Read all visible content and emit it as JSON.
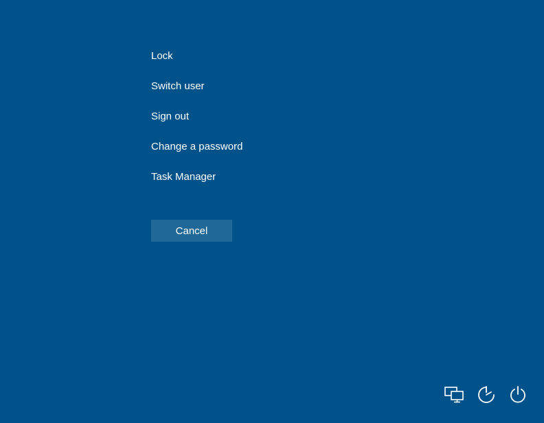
{
  "menu": {
    "items": [
      {
        "label": "Lock"
      },
      {
        "label": "Switch user"
      },
      {
        "label": "Sign out"
      },
      {
        "label": "Change a password"
      },
      {
        "label": "Task Manager"
      }
    ]
  },
  "cancel": {
    "label": "Cancel"
  },
  "icons": {
    "network": "network-icon",
    "ease_of_access": "ease-of-access-icon",
    "power": "power-icon"
  }
}
